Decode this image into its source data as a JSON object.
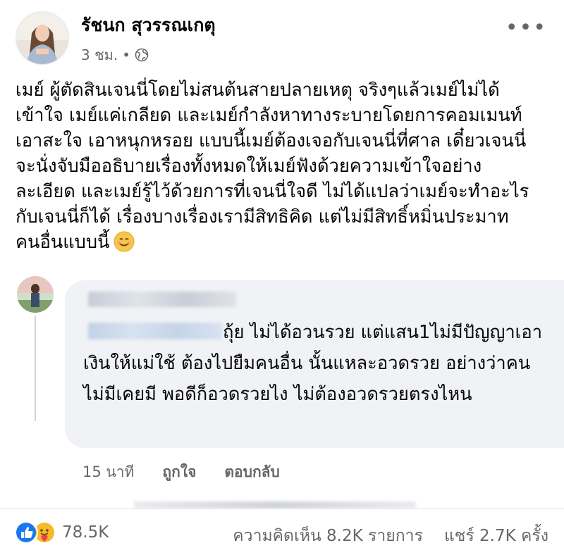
{
  "post": {
    "author": "รัชนก สุวรรณเกตุ",
    "time": "3 ชม.",
    "separator": "•",
    "more": "•••",
    "lines": [
      "เมย์ ผู้ตัดสินเจนนี่โดยไม่สนต้นสายปลายเหตุ จริงๆแล้วเมย์ไม่ได้",
      "เข้าใจ เมย์แค่เกลียด และเมย์กำลังหาทางระบายโดยการคอมเมนท์",
      "เอาสะใจ เอาหนุกหรอย แบบนี้เมย์ต้องเจอกับเจนนี่ที่ศาล เดี๋ยวเจนนี่",
      "จะนั่งจับมืออธิบายเรื่องทั้งหมดให้เมย์ฟังด้วยความเข้าใจอย่าง",
      "ละเอียด และเมย์รู้ไว้ด้วยการที่เจนนี่ใจดี ไม่ได้แปลว่าเมย์จะทำอะไร",
      "กับเจนนี่ก็ได้ เรื่องบางเรื่องเรามีสิทธิคิด แต่ไม่มีสิทธิ์หมิ่นประมาท",
      "คนอื่นแบบนี้"
    ]
  },
  "comment": {
    "text": "ถุ้ย ไม่ได้อวนรวย แต่แสน1ไม่มีปัญญาเอาเงินให้แม่ใช้ ต้องไปยืมคนอื่น นั้นแหละอวดรวย อย่างว่าคนไม่มีเคยมี พอดีก็อวดรวยไง ไม่ต้องอวดรวยตรงไหน",
    "time": "15 นาที",
    "like": "ถูกใจ",
    "reply": "ตอบกลับ"
  },
  "footer": {
    "reaction_count": "78.5K",
    "comments": "ความคิดเห็น 8.2K รายการ",
    "shares": "แชร์ 2.7K ครั้ง"
  },
  "icons": {
    "globe": "globe-icon",
    "more": "more-options-icon",
    "smile": "smiling-face-emoji",
    "like": "like-reaction-icon",
    "care": "care-reaction-icon"
  },
  "colors": {
    "text": "#050505",
    "secondary": "#65676b",
    "bubble": "#f0f2f5",
    "like_blue": "#1877f2",
    "care_yellow": "#f7b928"
  }
}
